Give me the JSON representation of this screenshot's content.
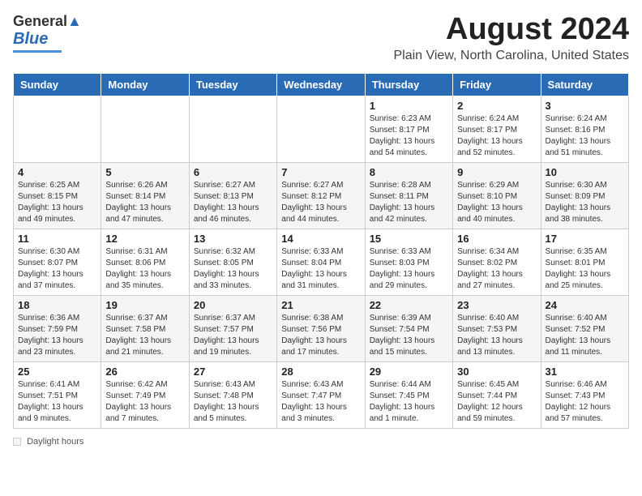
{
  "header": {
    "logo_line1": "General",
    "logo_line2": "Blue",
    "main_title": "August 2024",
    "subtitle": "Plain View, North Carolina, United States"
  },
  "calendar": {
    "headers": [
      "Sunday",
      "Monday",
      "Tuesday",
      "Wednesday",
      "Thursday",
      "Friday",
      "Saturday"
    ],
    "weeks": [
      [
        {
          "day": "",
          "detail": ""
        },
        {
          "day": "",
          "detail": ""
        },
        {
          "day": "",
          "detail": ""
        },
        {
          "day": "",
          "detail": ""
        },
        {
          "day": "1",
          "detail": "Sunrise: 6:23 AM\nSunset: 8:17 PM\nDaylight: 13 hours\nand 54 minutes."
        },
        {
          "day": "2",
          "detail": "Sunrise: 6:24 AM\nSunset: 8:17 PM\nDaylight: 13 hours\nand 52 minutes."
        },
        {
          "day": "3",
          "detail": "Sunrise: 6:24 AM\nSunset: 8:16 PM\nDaylight: 13 hours\nand 51 minutes."
        }
      ],
      [
        {
          "day": "4",
          "detail": "Sunrise: 6:25 AM\nSunset: 8:15 PM\nDaylight: 13 hours\nand 49 minutes."
        },
        {
          "day": "5",
          "detail": "Sunrise: 6:26 AM\nSunset: 8:14 PM\nDaylight: 13 hours\nand 47 minutes."
        },
        {
          "day": "6",
          "detail": "Sunrise: 6:27 AM\nSunset: 8:13 PM\nDaylight: 13 hours\nand 46 minutes."
        },
        {
          "day": "7",
          "detail": "Sunrise: 6:27 AM\nSunset: 8:12 PM\nDaylight: 13 hours\nand 44 minutes."
        },
        {
          "day": "8",
          "detail": "Sunrise: 6:28 AM\nSunset: 8:11 PM\nDaylight: 13 hours\nand 42 minutes."
        },
        {
          "day": "9",
          "detail": "Sunrise: 6:29 AM\nSunset: 8:10 PM\nDaylight: 13 hours\nand 40 minutes."
        },
        {
          "day": "10",
          "detail": "Sunrise: 6:30 AM\nSunset: 8:09 PM\nDaylight: 13 hours\nand 38 minutes."
        }
      ],
      [
        {
          "day": "11",
          "detail": "Sunrise: 6:30 AM\nSunset: 8:07 PM\nDaylight: 13 hours\nand 37 minutes."
        },
        {
          "day": "12",
          "detail": "Sunrise: 6:31 AM\nSunset: 8:06 PM\nDaylight: 13 hours\nand 35 minutes."
        },
        {
          "day": "13",
          "detail": "Sunrise: 6:32 AM\nSunset: 8:05 PM\nDaylight: 13 hours\nand 33 minutes."
        },
        {
          "day": "14",
          "detail": "Sunrise: 6:33 AM\nSunset: 8:04 PM\nDaylight: 13 hours\nand 31 minutes."
        },
        {
          "day": "15",
          "detail": "Sunrise: 6:33 AM\nSunset: 8:03 PM\nDaylight: 13 hours\nand 29 minutes."
        },
        {
          "day": "16",
          "detail": "Sunrise: 6:34 AM\nSunset: 8:02 PM\nDaylight: 13 hours\nand 27 minutes."
        },
        {
          "day": "17",
          "detail": "Sunrise: 6:35 AM\nSunset: 8:01 PM\nDaylight: 13 hours\nand 25 minutes."
        }
      ],
      [
        {
          "day": "18",
          "detail": "Sunrise: 6:36 AM\nSunset: 7:59 PM\nDaylight: 13 hours\nand 23 minutes."
        },
        {
          "day": "19",
          "detail": "Sunrise: 6:37 AM\nSunset: 7:58 PM\nDaylight: 13 hours\nand 21 minutes."
        },
        {
          "day": "20",
          "detail": "Sunrise: 6:37 AM\nSunset: 7:57 PM\nDaylight: 13 hours\nand 19 minutes."
        },
        {
          "day": "21",
          "detail": "Sunrise: 6:38 AM\nSunset: 7:56 PM\nDaylight: 13 hours\nand 17 minutes."
        },
        {
          "day": "22",
          "detail": "Sunrise: 6:39 AM\nSunset: 7:54 PM\nDaylight: 13 hours\nand 15 minutes."
        },
        {
          "day": "23",
          "detail": "Sunrise: 6:40 AM\nSunset: 7:53 PM\nDaylight: 13 hours\nand 13 minutes."
        },
        {
          "day": "24",
          "detail": "Sunrise: 6:40 AM\nSunset: 7:52 PM\nDaylight: 13 hours\nand 11 minutes."
        }
      ],
      [
        {
          "day": "25",
          "detail": "Sunrise: 6:41 AM\nSunset: 7:51 PM\nDaylight: 13 hours\nand 9 minutes."
        },
        {
          "day": "26",
          "detail": "Sunrise: 6:42 AM\nSunset: 7:49 PM\nDaylight: 13 hours\nand 7 minutes."
        },
        {
          "day": "27",
          "detail": "Sunrise: 6:43 AM\nSunset: 7:48 PM\nDaylight: 13 hours\nand 5 minutes."
        },
        {
          "day": "28",
          "detail": "Sunrise: 6:43 AM\nSunset: 7:47 PM\nDaylight: 13 hours\nand 3 minutes."
        },
        {
          "day": "29",
          "detail": "Sunrise: 6:44 AM\nSunset: 7:45 PM\nDaylight: 13 hours\nand 1 minute."
        },
        {
          "day": "30",
          "detail": "Sunrise: 6:45 AM\nSunset: 7:44 PM\nDaylight: 12 hours\nand 59 minutes."
        },
        {
          "day": "31",
          "detail": "Sunrise: 6:46 AM\nSunset: 7:43 PM\nDaylight: 12 hours\nand 57 minutes."
        }
      ]
    ]
  },
  "footer": {
    "daylight_label": "Daylight hours"
  }
}
